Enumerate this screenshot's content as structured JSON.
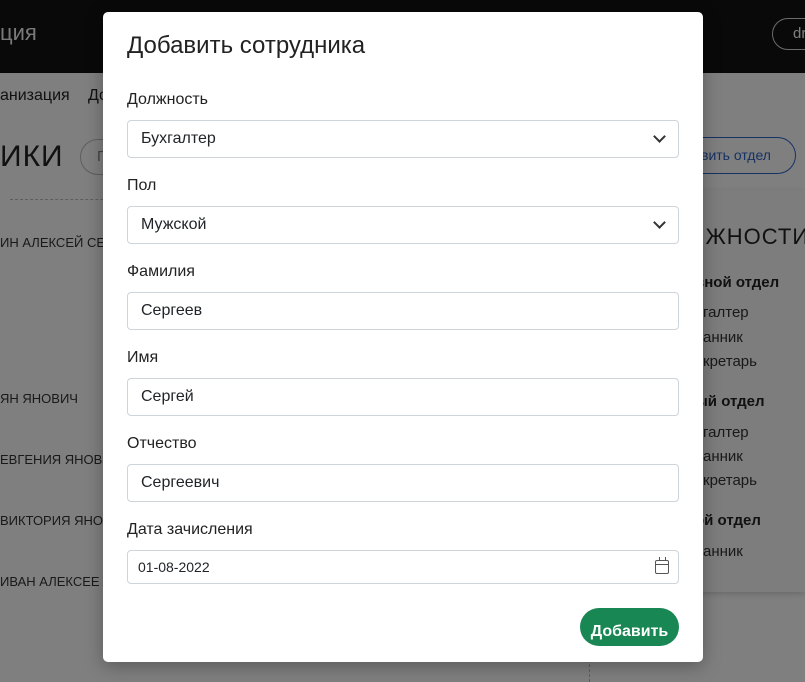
{
  "background": {
    "brand_fragment": "ция",
    "user_fragment": "dr",
    "nav": [
      "анизация",
      "До"
    ],
    "page_title_fragment": "ИКИ",
    "search_fragment": "П",
    "employees": [
      "ИН АЛЕКСЕЙ СЕР",
      "ЯН ЯНОВИЧ",
      "ЕВГЕНИЯ ЯНОВ",
      "ВИКТОРИЯ ЯНОВ",
      "ИВАН АЛЕКСЕЕ"
    ],
    "add_dept_fragment": "вить отдел",
    "side_title_fragment": "ЛЖНОСТИ",
    "departments": [
      {
        "name": "вной отдел",
        "positions": [
          "галтер",
          "анник",
          "кретарь"
        ]
      },
      {
        "name": "ый отдел",
        "positions": [
          "галтер",
          "анник",
          "кретарь"
        ]
      },
      {
        "name": "ой отдел",
        "positions": [
          "анник"
        ]
      }
    ]
  },
  "modal": {
    "title": "Добавить сотрудника",
    "position": {
      "label": "Должность",
      "value": "Бухгалтер"
    },
    "gender": {
      "label": "Пол",
      "value": "Мужской"
    },
    "last_name": {
      "label": "Фамилия",
      "value": "Сергеев"
    },
    "first_name": {
      "label": "Имя",
      "value": "Сергей"
    },
    "patronymic": {
      "label": "Отчество",
      "value": "Сергеевич"
    },
    "enroll_date": {
      "label": "Дата зачисления",
      "value": "01-08-2022"
    },
    "submit_label": "Добавить"
  },
  "icons": {
    "select": "chevron-down-icon",
    "date": "calendar-icon"
  },
  "colors": {
    "submit": "#198754",
    "accent": "#2d63c8",
    "topbar": "#121212"
  }
}
